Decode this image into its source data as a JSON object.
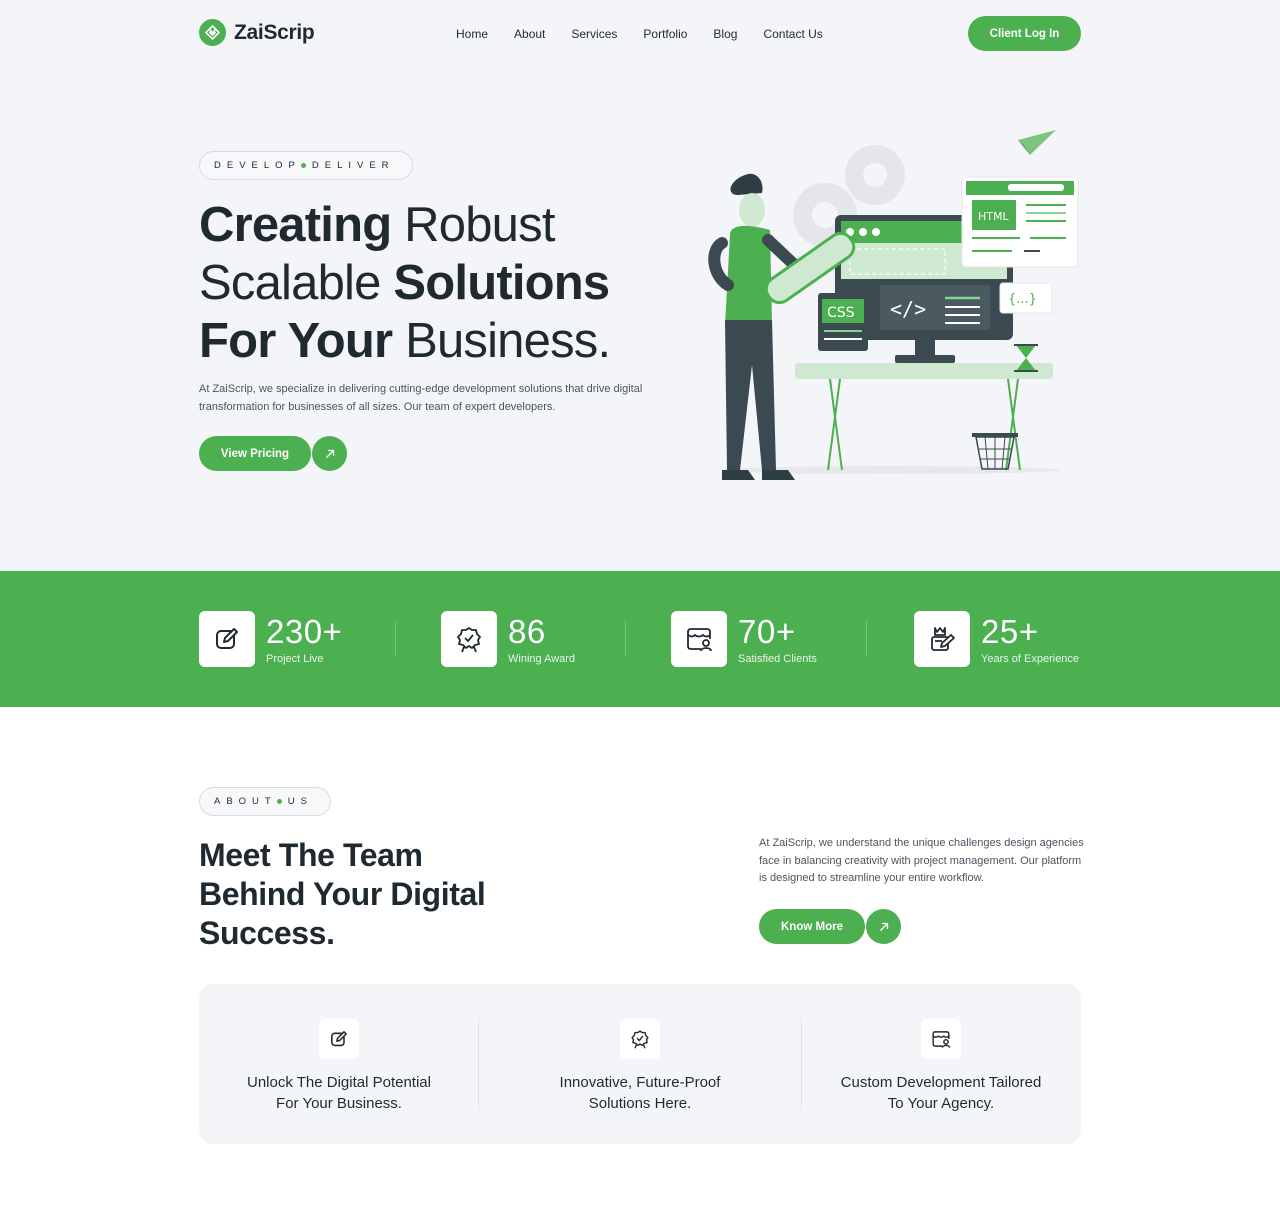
{
  "header": {
    "brand": "ZaiScrip",
    "nav": [
      "Home",
      "About",
      "Services",
      "Portfolio",
      "Blog",
      "Contact Us"
    ],
    "cta": "Client Log In"
  },
  "hero": {
    "eyebrow_a": "DEVELOP",
    "eyebrow_b": "DELIVER",
    "title_l1_bold": "Creating",
    "title_l1_light": " Robust",
    "title_l2_light": "Scalable ",
    "title_l2_bold": "Solutions",
    "title_l3_bold": "For Your",
    "title_l3_light": " Business.",
    "description": "At ZaiScrip, we specialize in delivering cutting-edge development solutions that drive digital transformation for businesses of all sizes. Our team of expert developers.",
    "cta": "View Pricing",
    "illustration": {
      "html_tag": "HTML",
      "css_tag": "CSS",
      "code_tag": "</>",
      "braces_tag": "{...}"
    }
  },
  "stats": [
    {
      "value": "230+",
      "label": "Project Live",
      "icon": "edit-icon"
    },
    {
      "value": "86",
      "label": "Wining Award",
      "icon": "award-badge-icon"
    },
    {
      "value": "70+",
      "label": "Satisfied Clients",
      "icon": "clients-icon"
    },
    {
      "value": "25+",
      "label": "Years of Experience",
      "icon": "experience-icon"
    }
  ],
  "about": {
    "eyebrow_a": "ABOUT",
    "eyebrow_b": "US",
    "title_l1_bold": "Meet The",
    "title_l1_light": " Team",
    "title_l2_light": "Behind Your ",
    "title_l2_bold": "Digital",
    "title_l3_bold": "Success.",
    "description": "At ZaiScrip, we understand the unique challenges design agencies face in balancing creativity with project management. Our platform is designed to streamline your entire workflow.",
    "cta": "Know More"
  },
  "features": [
    {
      "line1": "Unlock The Digital Potential",
      "line2": "For Your Business.",
      "icon": "edit-icon"
    },
    {
      "line1": "Innovative, Future-Proof",
      "line2": "Solutions Here.",
      "icon": "award-badge-icon"
    },
    {
      "line1": "Custom Development Tailored",
      "line2": "To Your Agency.",
      "icon": "clients-icon"
    }
  ],
  "colors": {
    "accent": "#4caf50",
    "dark": "#1f2a30",
    "hero_bg": "#f4f5f8"
  }
}
